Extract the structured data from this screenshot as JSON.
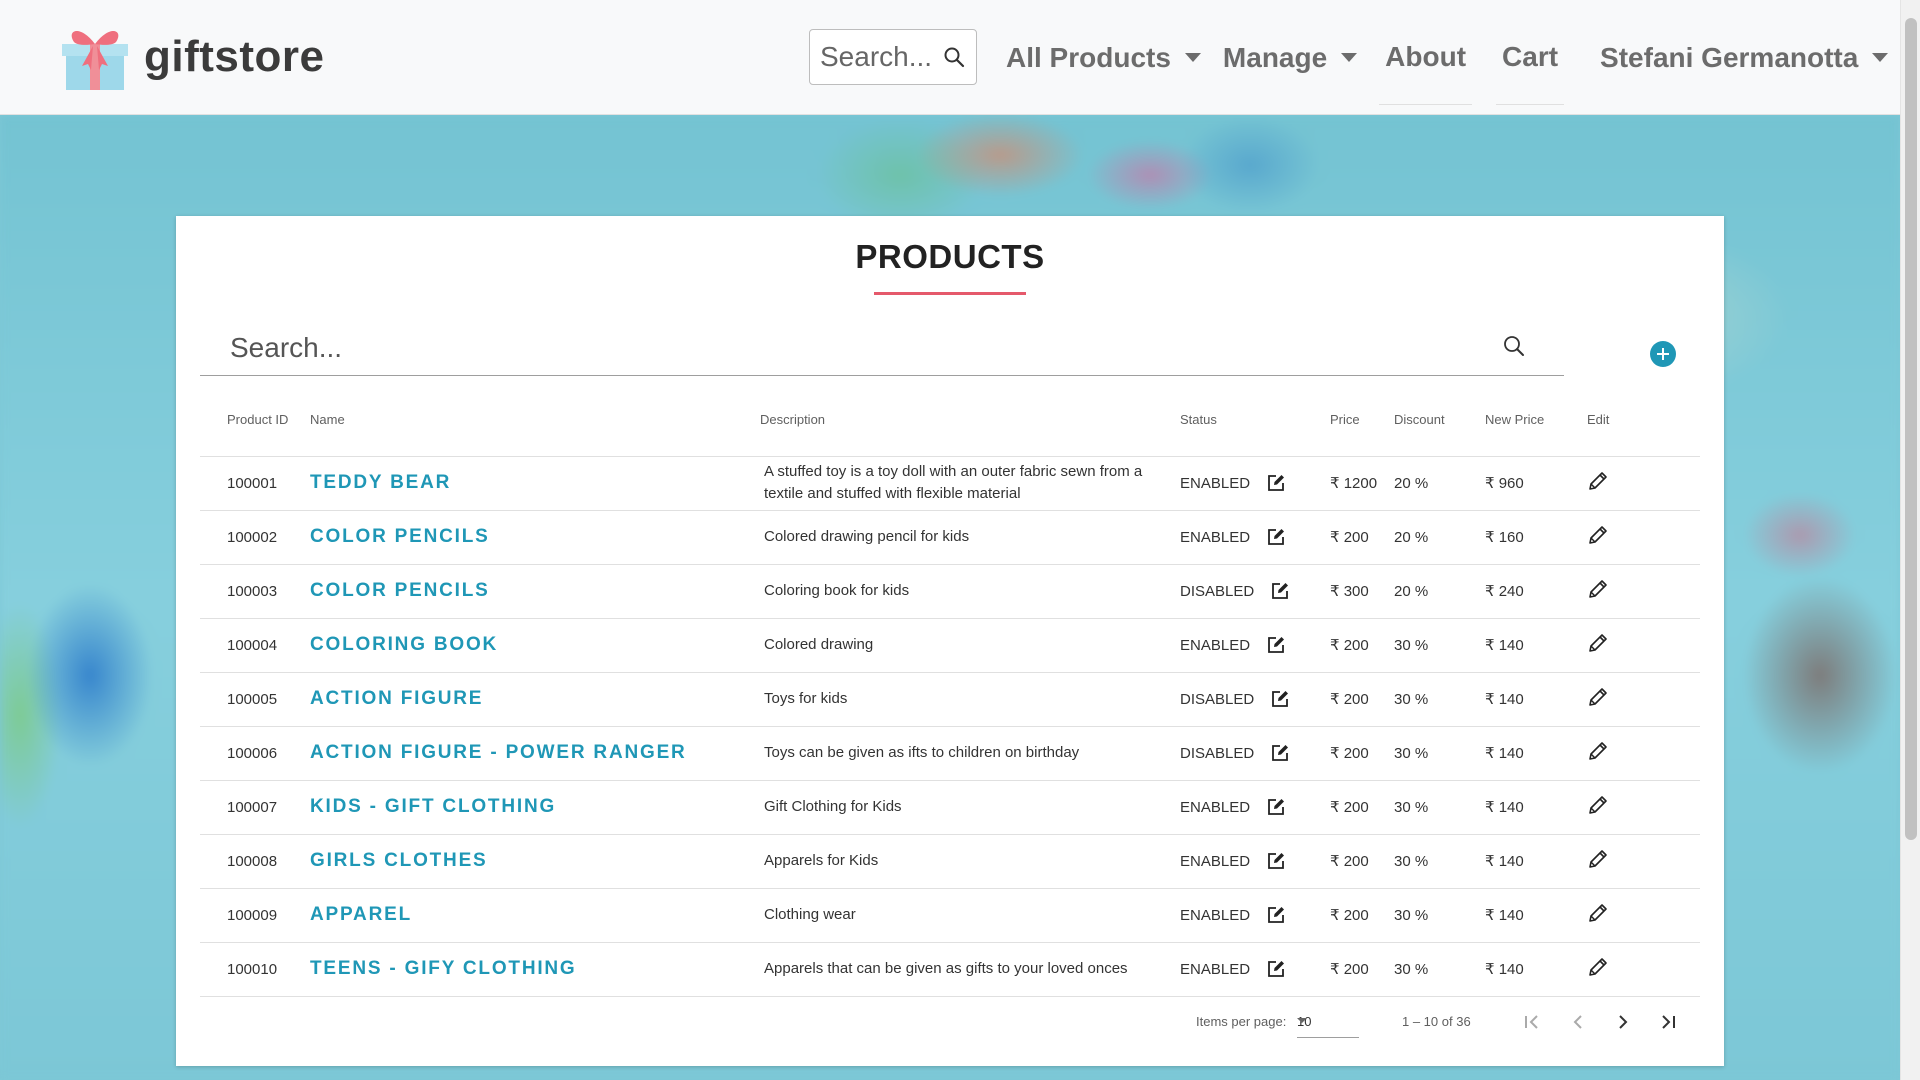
{
  "brand": {
    "name": "giftstore"
  },
  "nav": {
    "search_placeholder": "Search...",
    "items": [
      {
        "label": "All Products",
        "dropdown": true
      },
      {
        "label": "Manage",
        "dropdown": true
      },
      {
        "label": "About",
        "dropdown": false
      },
      {
        "label": "Cart",
        "dropdown": false
      },
      {
        "label": "Stefani Germanotta",
        "dropdown": true
      }
    ]
  },
  "page": {
    "title": "PRODUCTS",
    "search_placeholder": "Search...",
    "accent_color": "#1f97b6",
    "underline_color": "#e5596b"
  },
  "table": {
    "columns": [
      "Product ID",
      "Name",
      "Description",
      "Status",
      "Price",
      "Discount",
      "New Price",
      "Edit"
    ],
    "rows": [
      {
        "id": "100001",
        "name": "TEDDY BEAR",
        "description": "A stuffed toy is a toy doll with an outer fabric sewn from a textile and stuffed with flexible material",
        "status": "ENABLED",
        "price": "₹ 1200",
        "discount": "20 %",
        "new_price": "₹ 960"
      },
      {
        "id": "100002",
        "name": "COLOR PENCILS",
        "description": "Colored drawing pencil for kids",
        "status": "ENABLED",
        "price": "₹ 200",
        "discount": "20 %",
        "new_price": "₹ 160"
      },
      {
        "id": "100003",
        "name": "COLOR PENCILS",
        "description": "Coloring book for kids",
        "status": "DISABLED",
        "price": "₹ 300",
        "discount": "20 %",
        "new_price": "₹ 240"
      },
      {
        "id": "100004",
        "name": "COLORING BOOK",
        "description": "Colored drawing",
        "status": "ENABLED",
        "price": "₹ 200",
        "discount": "30 %",
        "new_price": "₹ 140"
      },
      {
        "id": "100005",
        "name": "ACTION FIGURE",
        "description": "Toys for kids",
        "status": "DISABLED",
        "price": "₹ 200",
        "discount": "30 %",
        "new_price": "₹ 140"
      },
      {
        "id": "100006",
        "name": "ACTION FIGURE - POWER RANGER",
        "description": "Toys can be given as ifts to children on birthday",
        "status": "DISABLED",
        "price": "₹ 200",
        "discount": "30 %",
        "new_price": "₹ 140"
      },
      {
        "id": "100007",
        "name": "KIDS - GIFT CLOTHING",
        "description": "Gift Clothing for Kids",
        "status": "ENABLED",
        "price": "₹ 200",
        "discount": "30 %",
        "new_price": "₹ 140"
      },
      {
        "id": "100008",
        "name": "GIRLS CLOTHES",
        "description": "Apparels for Kids",
        "status": "ENABLED",
        "price": "₹ 200",
        "discount": "30 %",
        "new_price": "₹ 140"
      },
      {
        "id": "100009",
        "name": "APPAREL",
        "description": "Clothing wear",
        "status": "ENABLED",
        "price": "₹ 200",
        "discount": "30 %",
        "new_price": "₹ 140"
      },
      {
        "id": "100010",
        "name": "TEENS - GIFY CLOTHING",
        "description": "Apparels that can be given as gifts to your loved onces",
        "status": "ENABLED",
        "price": "₹ 200",
        "discount": "30 %",
        "new_price": "₹ 140"
      }
    ]
  },
  "paginator": {
    "items_per_page_label": "Items per page:",
    "items_per_page": "10",
    "range_label": "1 – 10 of 36"
  },
  "icons": {
    "nav_search": "search-icon",
    "table_search": "search-icon",
    "add": "plus-circle-icon",
    "status_edit": "edit-square-icon",
    "row_edit": "pencil-icon",
    "first_page": "first-page-icon",
    "prev_page": "chevron-left-icon",
    "next_page": "chevron-right-icon",
    "last_page": "last-page-icon"
  }
}
